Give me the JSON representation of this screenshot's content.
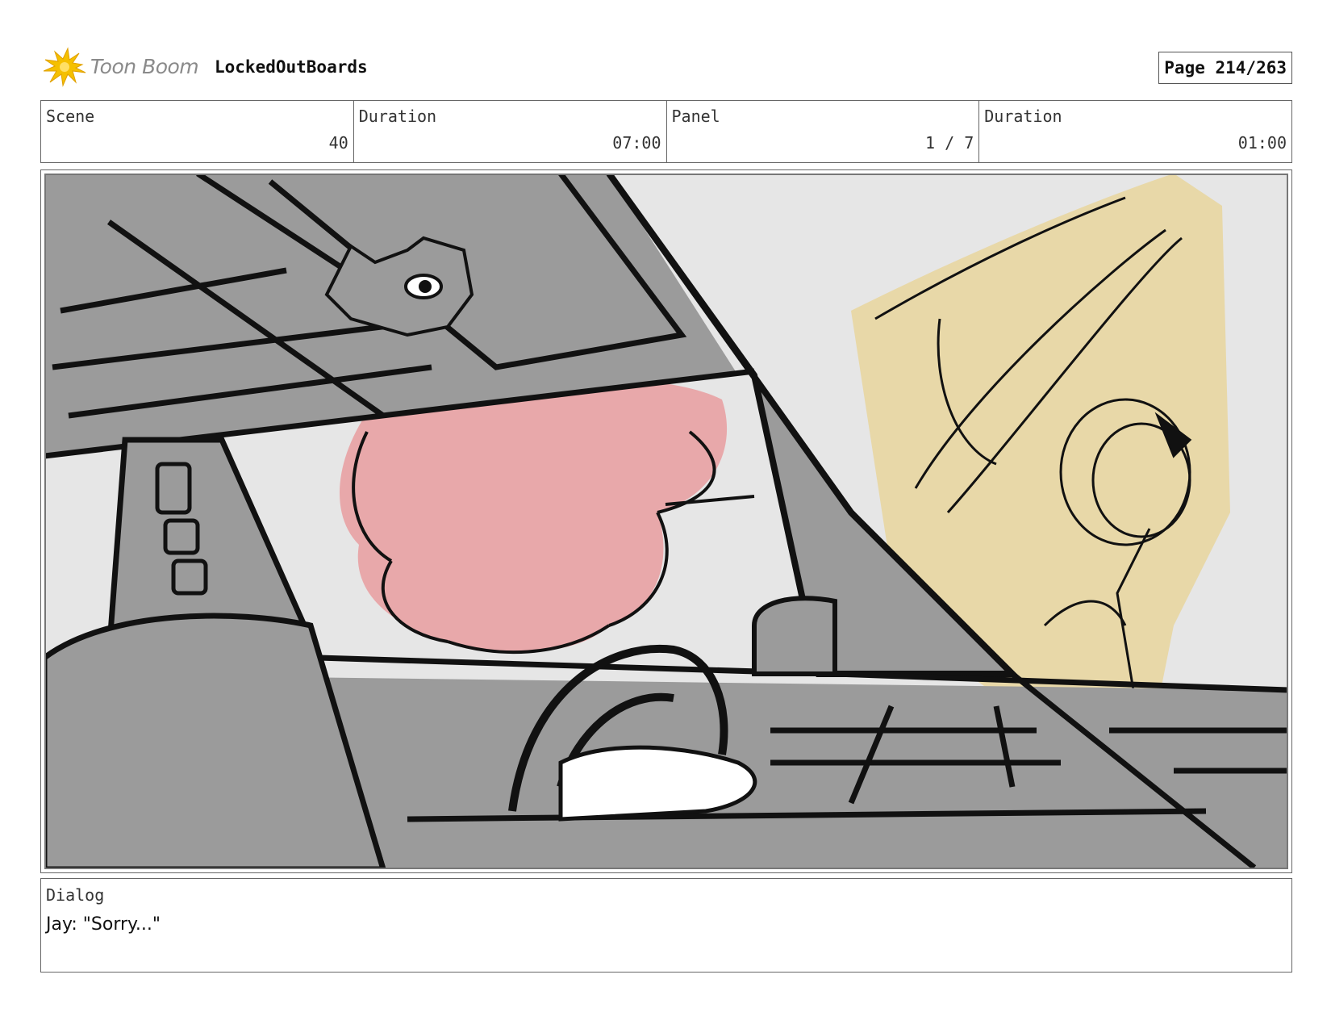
{
  "header": {
    "logo_text": "Toon Boom",
    "project_name": "LockedOutBoards",
    "page_label": "Page 214/263"
  },
  "info": {
    "scene_label": "Scene",
    "scene_value": "40",
    "scene_duration_label": "Duration",
    "scene_duration_value": "07:00",
    "panel_label": "Panel",
    "panel_value": "1 / 7",
    "panel_duration_label": "Duration",
    "panel_duration_value": "01:00"
  },
  "dialog": {
    "label": "Dialog",
    "text": "Jay: \"Sorry...\""
  },
  "colors": {
    "logo_yellow": "#f5c000",
    "car_gray": "#9b9b9b",
    "sky_gray": "#e6e6e6",
    "character_pink": "#e8a8aa",
    "character_tan": "#e8d8a8",
    "ink": "#111111"
  }
}
